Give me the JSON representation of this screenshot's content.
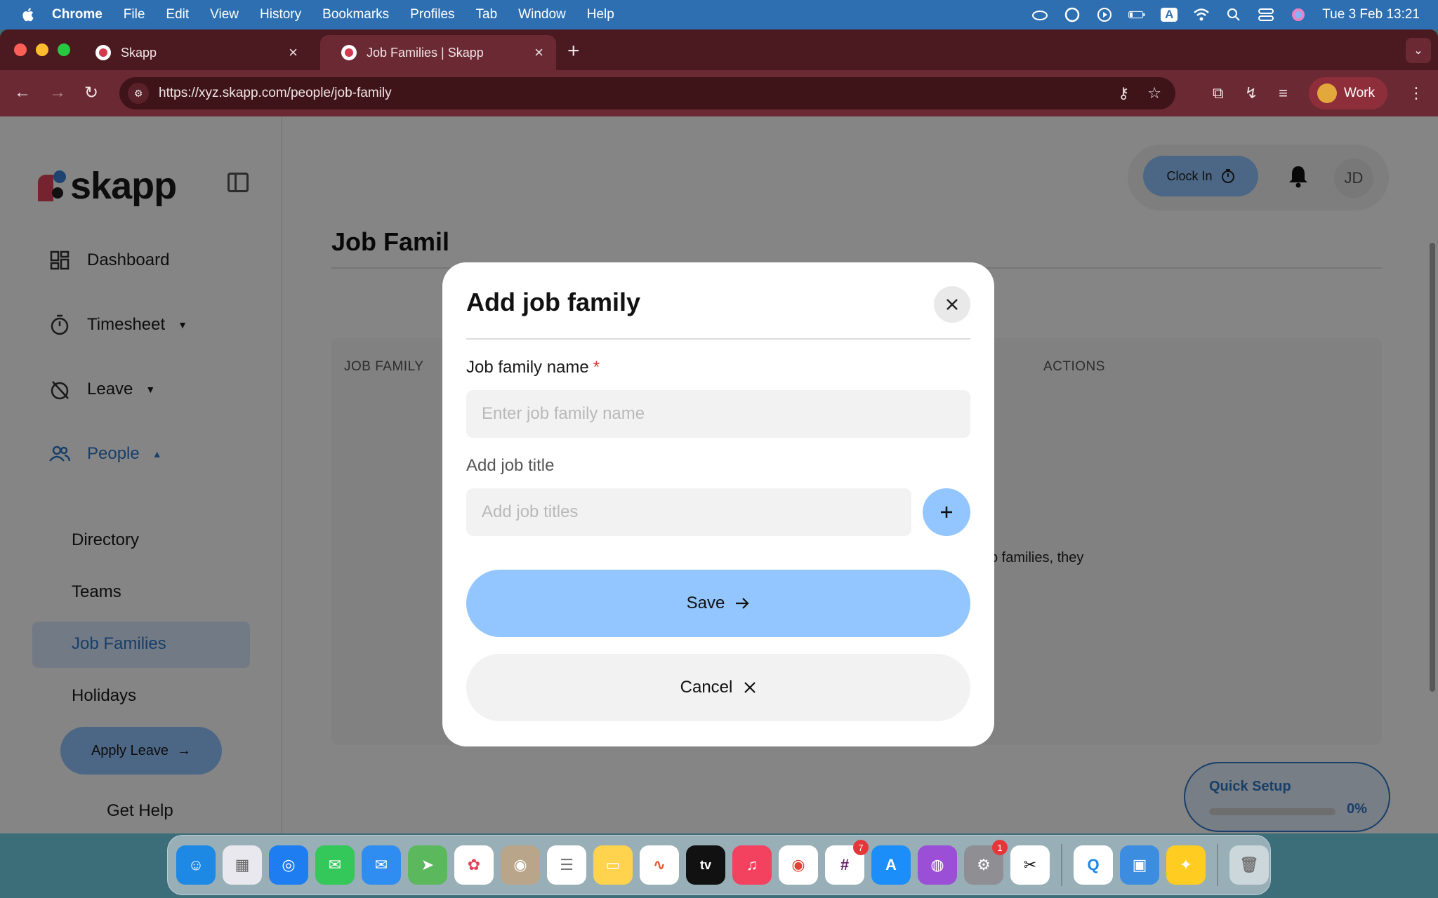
{
  "menubar": {
    "app": "Chrome",
    "items": [
      "File",
      "Edit",
      "View",
      "History",
      "Bookmarks",
      "Profiles",
      "Tab",
      "Window",
      "Help"
    ],
    "datetime": "Tue 3 Feb  13:21",
    "input_source": "A"
  },
  "browser": {
    "tabs": [
      {
        "title": "Skapp"
      },
      {
        "title": "Job Families | Skapp"
      }
    ],
    "url": "https://xyz.skapp.com/people/job-family",
    "profile": "Work"
  },
  "sidebar": {
    "logo": "skapp",
    "nav": [
      {
        "label": "Dashboard",
        "icon": "dashboard-icon"
      },
      {
        "label": "Timesheet",
        "icon": "stopwatch-icon"
      },
      {
        "label": "Leave",
        "icon": "leave-icon"
      },
      {
        "label": "People",
        "icon": "people-icon"
      }
    ],
    "people_sub": [
      "Directory",
      "Teams",
      "Job Families",
      "Holidays"
    ],
    "apply_leave": "Apply Leave",
    "get_help": "Get Help"
  },
  "header": {
    "clock_in": "Clock In",
    "avatar_initials": "JD"
  },
  "main": {
    "title": "Job Famil",
    "columns": [
      "JOB FAMILY",
      "ACTIONS"
    ],
    "empty_fragment": "b families, they"
  },
  "quick_setup": {
    "title": "Quick Setup",
    "percent_label": "0%",
    "progress": 0
  },
  "modal": {
    "title": "Add job family",
    "name_label": "Job family name",
    "required_mark": "*",
    "name_value": "",
    "name_placeholder": "Enter job family name",
    "title_label": "Add job title",
    "title_value": "",
    "title_placeholder": "Add job titles",
    "save": "Save",
    "cancel": "Cancel"
  },
  "dock": {
    "slack_badge": "7",
    "settings_badge": "1",
    "tv_label": "tv"
  },
  "colors": {
    "accent": "#93c6ff",
    "primary_text_blue": "#2f79c9",
    "browser_frame": "#6b2a33",
    "required": "#e03131"
  }
}
